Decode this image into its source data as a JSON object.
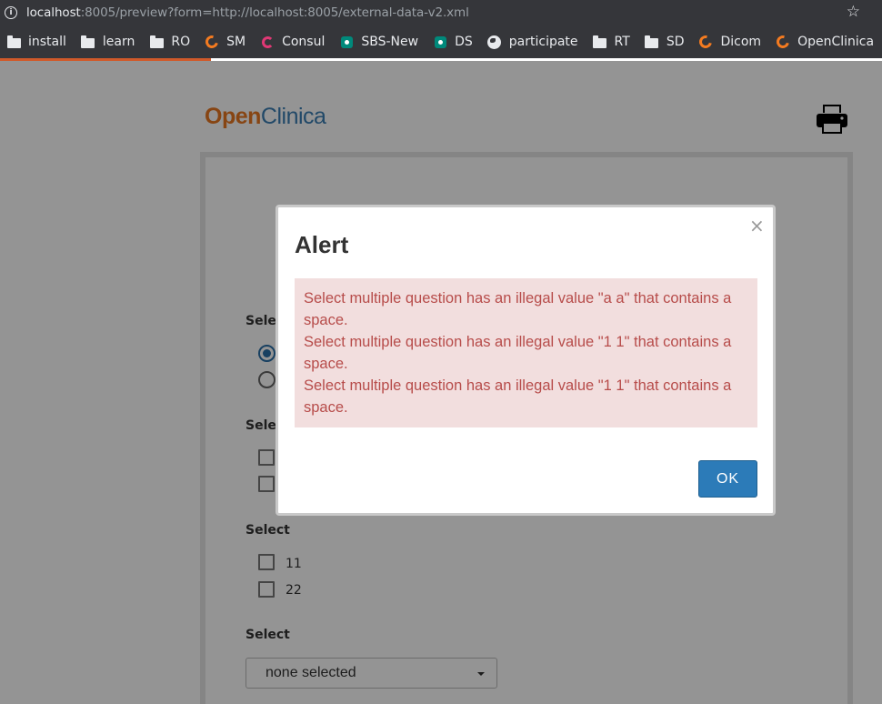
{
  "browser": {
    "url_host": "localhost",
    "url_rest": ":8005/preview?form=http://localhost:8005/external-data-v2.xml",
    "bookmarks": [
      {
        "label": "install",
        "icon": "folder-icon"
      },
      {
        "label": "learn",
        "icon": "folder-icon"
      },
      {
        "label": "RO",
        "icon": "folder-icon"
      },
      {
        "label": "SM",
        "icon": "openclinica-icon"
      },
      {
        "label": "Consul",
        "icon": "consul-icon"
      },
      {
        "label": "SBS-New",
        "icon": "meet-icon"
      },
      {
        "label": "DS",
        "icon": "meet-icon"
      },
      {
        "label": "participate",
        "icon": "globe-icon"
      },
      {
        "label": "RT",
        "icon": "folder-icon"
      },
      {
        "label": "SD",
        "icon": "folder-icon"
      },
      {
        "label": "Dicom",
        "icon": "openclinica-icon"
      },
      {
        "label": "OpenClinica",
        "icon": "openclinica-icon"
      }
    ]
  },
  "page": {
    "logo_open": "Open",
    "logo_clinica": "Clinica",
    "questions": [
      {
        "label": "Selec"
      },
      {
        "label": "Selec"
      },
      {
        "label": "Select",
        "options": [
          "11",
          "22"
        ]
      },
      {
        "label": "Select"
      }
    ],
    "dropdown_value": "none selected"
  },
  "modal": {
    "title": "Alert",
    "close_symbol": "×",
    "messages": [
      "Select multiple question has an illegal value \"a a\" that contains a space.",
      "Select multiple question has an illegal value \"1 1\" that contains a space.",
      "Select multiple question has an illegal value \"1 1\" that contains a space."
    ],
    "ok_label": "OK"
  }
}
